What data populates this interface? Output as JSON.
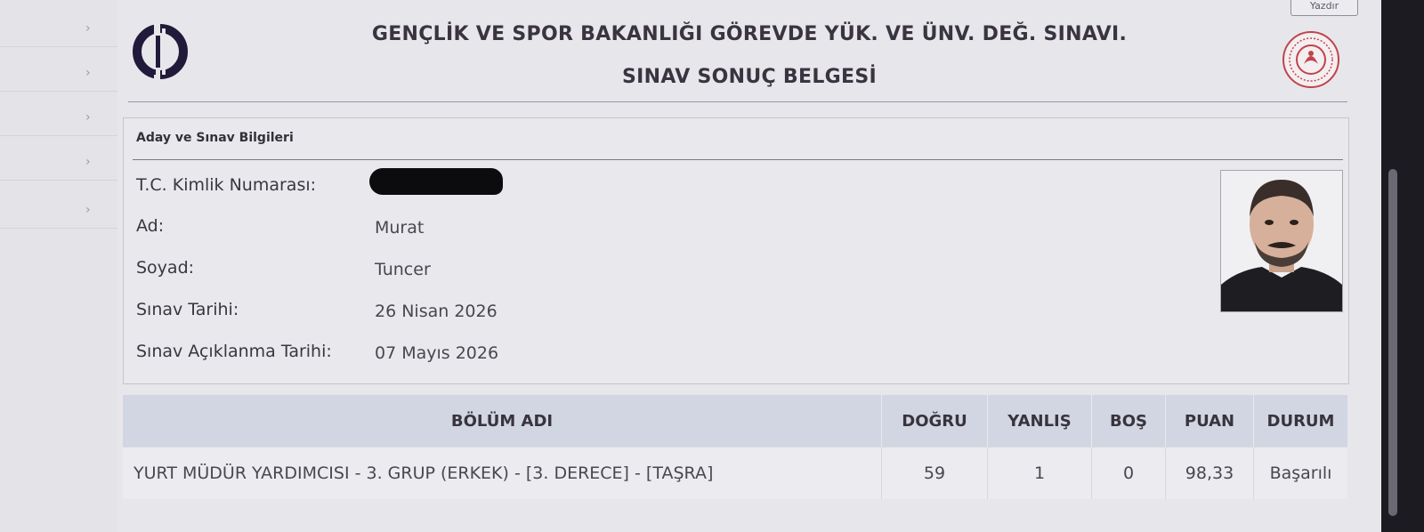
{
  "header": {
    "title": "GENÇLİK VE SPOR BAKANLIĞI GÖREVDE YÜK. VE ÜNV. DEĞ. SINAVI.",
    "subtitle": "SINAV SONUÇ BELGESİ",
    "print_button_label": "Yazdır"
  },
  "icons": {
    "left_logo": "osym-logo",
    "right_logo": "ministry-seal",
    "sidebar_chevron": "chevron-right-icon"
  },
  "candidate_panel": {
    "title": "Aday ve Sınav Bilgileri",
    "fields": [
      {
        "label": "T.C. Kimlik Numarası:",
        "value": ""
      },
      {
        "label": "Ad:",
        "value": "Murat"
      },
      {
        "label": "Soyad:",
        "value": "Tuncer"
      },
      {
        "label": "Sınav Tarihi:",
        "value": "26 Nisan 2026"
      },
      {
        "label": "Sınav Açıklanma Tarihi:",
        "value": "07 Mayıs 2026"
      }
    ]
  },
  "results_table": {
    "headers": [
      "BÖLÜM ADI",
      "DOĞRU",
      "YANLIŞ",
      "BOŞ",
      "PUAN",
      "DURUM"
    ],
    "rows": [
      [
        "YURT MÜDÜR YARDIMCISI - 3. GRUP (ERKEK) - [3. DERECE] - [TAŞRA]",
        "59",
        "1",
        "0",
        "98,33",
        "Başarılı"
      ]
    ]
  },
  "colors": {
    "page_background": "#e7e7eb",
    "table_header_background": "#d2d6e2",
    "heading_text": "#3a3440",
    "logo_dark": "#221a3a",
    "seal_red": "#c0444c"
  }
}
